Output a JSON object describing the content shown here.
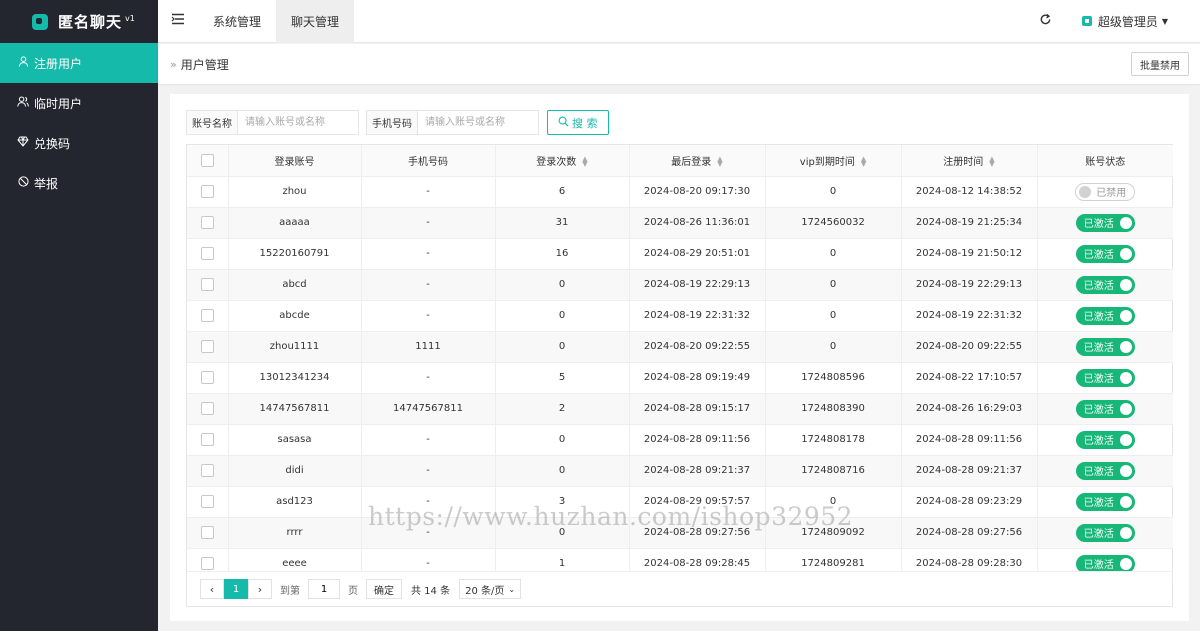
{
  "app": {
    "name": "匿名聊天",
    "version": "v1"
  },
  "sidebar": {
    "items": [
      {
        "label": "注册用户",
        "icon": "user-icon"
      },
      {
        "label": "临时用户",
        "icon": "users-icon"
      },
      {
        "label": "兑换码",
        "icon": "diamond-icon"
      },
      {
        "label": "举报",
        "icon": "ban-icon"
      }
    ],
    "active_index": 0
  },
  "header": {
    "tabs": [
      "系统管理",
      "聊天管理"
    ],
    "active_tab": 1,
    "user": "超级管理员"
  },
  "breadcrumb": {
    "title": "用户管理"
  },
  "toolbar": {
    "batch_disable": "批量禁用"
  },
  "search": {
    "account_label": "账号名称",
    "account_placeholder": "请输入账号或名称",
    "phone_label": "手机号码",
    "phone_placeholder": "请输入账号或名称",
    "button": "搜 索"
  },
  "table": {
    "columns": [
      "登录账号",
      "手机号码",
      "登录次数",
      "最后登录",
      "vip到期时间",
      "注册时间",
      "账号状态"
    ],
    "rows": [
      [
        "zhou",
        "-",
        "6",
        "2024-08-20 09:17:30",
        "0",
        "2024-08-12 14:38:52",
        "已禁用"
      ],
      [
        "aaaaa",
        "-",
        "31",
        "2024-08-26 11:36:01",
        "1724560032",
        "2024-08-19 21:25:34",
        "已激活"
      ],
      [
        "15220160791",
        "-",
        "16",
        "2024-08-29 20:51:01",
        "0",
        "2024-08-19 21:50:12",
        "已激活"
      ],
      [
        "abcd",
        "-",
        "0",
        "2024-08-19 22:29:13",
        "0",
        "2024-08-19 22:29:13",
        "已激活"
      ],
      [
        "abcde",
        "-",
        "0",
        "2024-08-19 22:31:32",
        "0",
        "2024-08-19 22:31:32",
        "已激活"
      ],
      [
        "zhou1111",
        "1111",
        "0",
        "2024-08-20 09:22:55",
        "0",
        "2024-08-20 09:22:55",
        "已激活"
      ],
      [
        "13012341234",
        "-",
        "5",
        "2024-08-28 09:19:49",
        "1724808596",
        "2024-08-22 17:10:57",
        "已激活"
      ],
      [
        "14747567811",
        "14747567811",
        "2",
        "2024-08-28 09:15:17",
        "1724808390",
        "2024-08-26 16:29:03",
        "已激活"
      ],
      [
        "sasasa",
        "-",
        "0",
        "2024-08-28 09:11:56",
        "1724808178",
        "2024-08-28 09:11:56",
        "已激活"
      ],
      [
        "didi",
        "-",
        "0",
        "2024-08-28 09:21:37",
        "1724808716",
        "2024-08-28 09:21:37",
        "已激活"
      ],
      [
        "asd123",
        "-",
        "3",
        "2024-08-29 09:57:57",
        "0",
        "2024-08-28 09:23:29",
        "已激活"
      ],
      [
        "rrrr",
        "-",
        "0",
        "2024-08-28 09:27:56",
        "1724809092",
        "2024-08-28 09:27:56",
        "已激活"
      ],
      [
        "eeee",
        "-",
        "1",
        "2024-08-28 09:28:45",
        "1724809281",
        "2024-08-28 09:28:30",
        "已激活"
      ]
    ]
  },
  "pagination": {
    "current": "1",
    "goto_label": "到第",
    "page_input": "1",
    "page_unit": "页",
    "confirm": "确定",
    "total": "共 14 条",
    "page_size": "20 条/页"
  },
  "watermark": "https://www.huzhan.com/ishop32952",
  "colors": {
    "accent": "#16baaa",
    "switch_on": "#16b777",
    "sidebar_bg": "#23262e"
  }
}
